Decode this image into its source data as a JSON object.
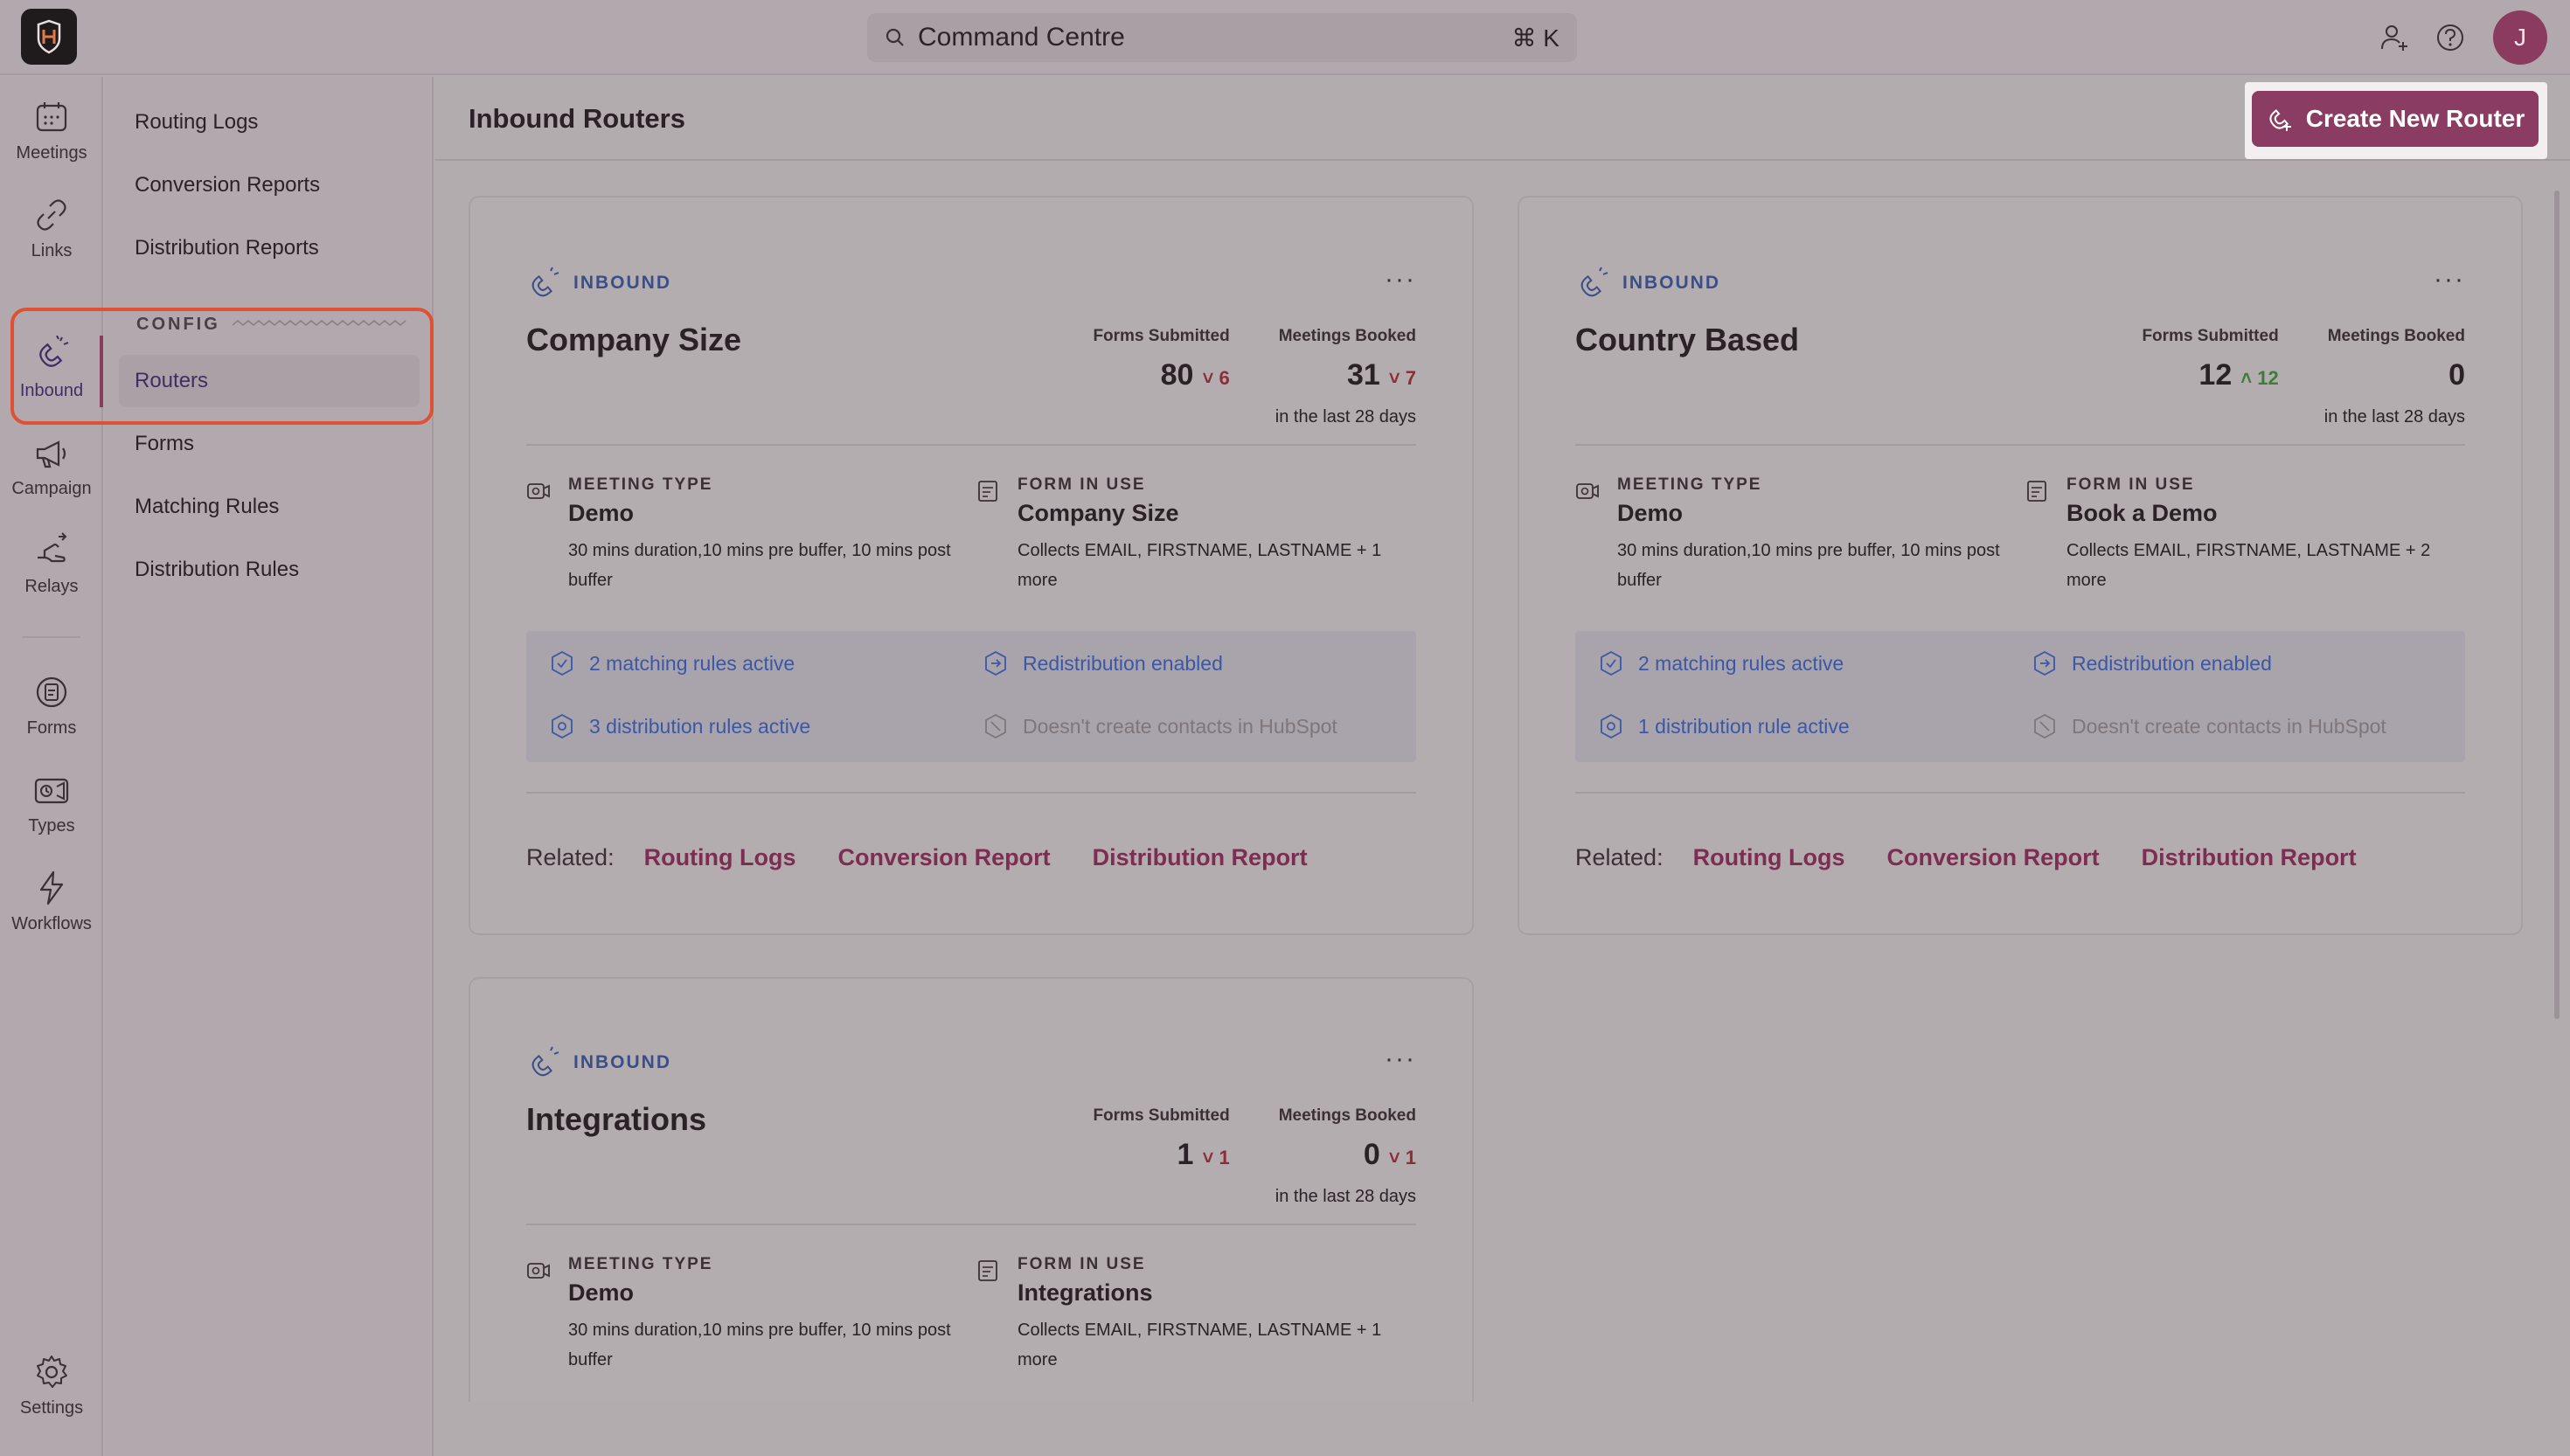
{
  "app": {
    "search_placeholder": "Command Centre",
    "search_shortcut": "⌘ K",
    "user_initial": "J",
    "accent": "#8b3c62",
    "highlight_color": "#e05034"
  },
  "rail": {
    "meetings": "Meetings",
    "links": "Links",
    "inbound": "Inbound",
    "campaign": "Campaign",
    "relays": "Relays",
    "forms": "Forms",
    "types": "Types",
    "workflows": "Workflows",
    "settings": "Settings"
  },
  "subnav": {
    "routing_logs": "Routing Logs",
    "conversion_reports": "Conversion Reports",
    "distribution_reports": "Distribution Reports",
    "config_header": "CONFIG",
    "routers": "Routers",
    "forms": "Forms",
    "matching_rules": "Matching Rules",
    "distribution_rules": "Distribution Rules"
  },
  "page": {
    "title": "Inbound Routers",
    "create_button": "Create New Router"
  },
  "common": {
    "tag": "INBOUND",
    "forms_submitted": "Forms Submitted",
    "meetings_booked": "Meetings Booked",
    "period": "in the last 28 days",
    "meeting_type_cap": "MEETING TYPE",
    "form_in_use_cap": "FORM IN USE",
    "related": "Related:",
    "routing_logs": "Routing Logs",
    "conversion_report": "Conversion Report",
    "distribution_report": "Distribution Report",
    "more": "···"
  },
  "cards": [
    {
      "name": "Company Size",
      "forms_value": "80",
      "forms_delta": "6",
      "forms_delta_dir": "down",
      "meetings_value": "31",
      "meetings_delta": "7",
      "meetings_delta_dir": "down",
      "meeting_type": "Demo",
      "meeting_desc": "30 mins duration,10 mins pre buffer, 10 mins post buffer",
      "form": "Company Size",
      "form_desc": "Collects EMAIL, FIRSTNAME, LASTNAME + 1 more",
      "matching": "2 matching rules active",
      "redistribution": "Redistribution enabled",
      "distribution": "3 distribution rules active",
      "contacts": "Doesn't create contacts in HubSpot"
    },
    {
      "name": "Country Based",
      "forms_value": "12",
      "forms_delta": "12",
      "forms_delta_dir": "up",
      "meetings_value": "0",
      "meetings_delta": "",
      "meetings_delta_dir": "",
      "meeting_type": "Demo",
      "meeting_desc": "30 mins duration,10 mins pre buffer, 10 mins post buffer",
      "form": "Book a Demo",
      "form_desc": "Collects EMAIL, FIRSTNAME, LASTNAME + 2 more",
      "matching": "2 matching rules active",
      "redistribution": "Redistribution enabled",
      "distribution": "1 distribution rule active",
      "contacts": "Doesn't create contacts in HubSpot"
    },
    {
      "name": "Integrations",
      "forms_value": "1",
      "forms_delta": "1",
      "forms_delta_dir": "down",
      "meetings_value": "0",
      "meetings_delta": "1",
      "meetings_delta_dir": "down",
      "meeting_type": "Demo",
      "meeting_desc": "30 mins duration,10 mins pre buffer, 10 mins post buffer",
      "form": "Integrations",
      "form_desc": "Collects EMAIL, FIRSTNAME, LASTNAME + 1 more"
    }
  ]
}
